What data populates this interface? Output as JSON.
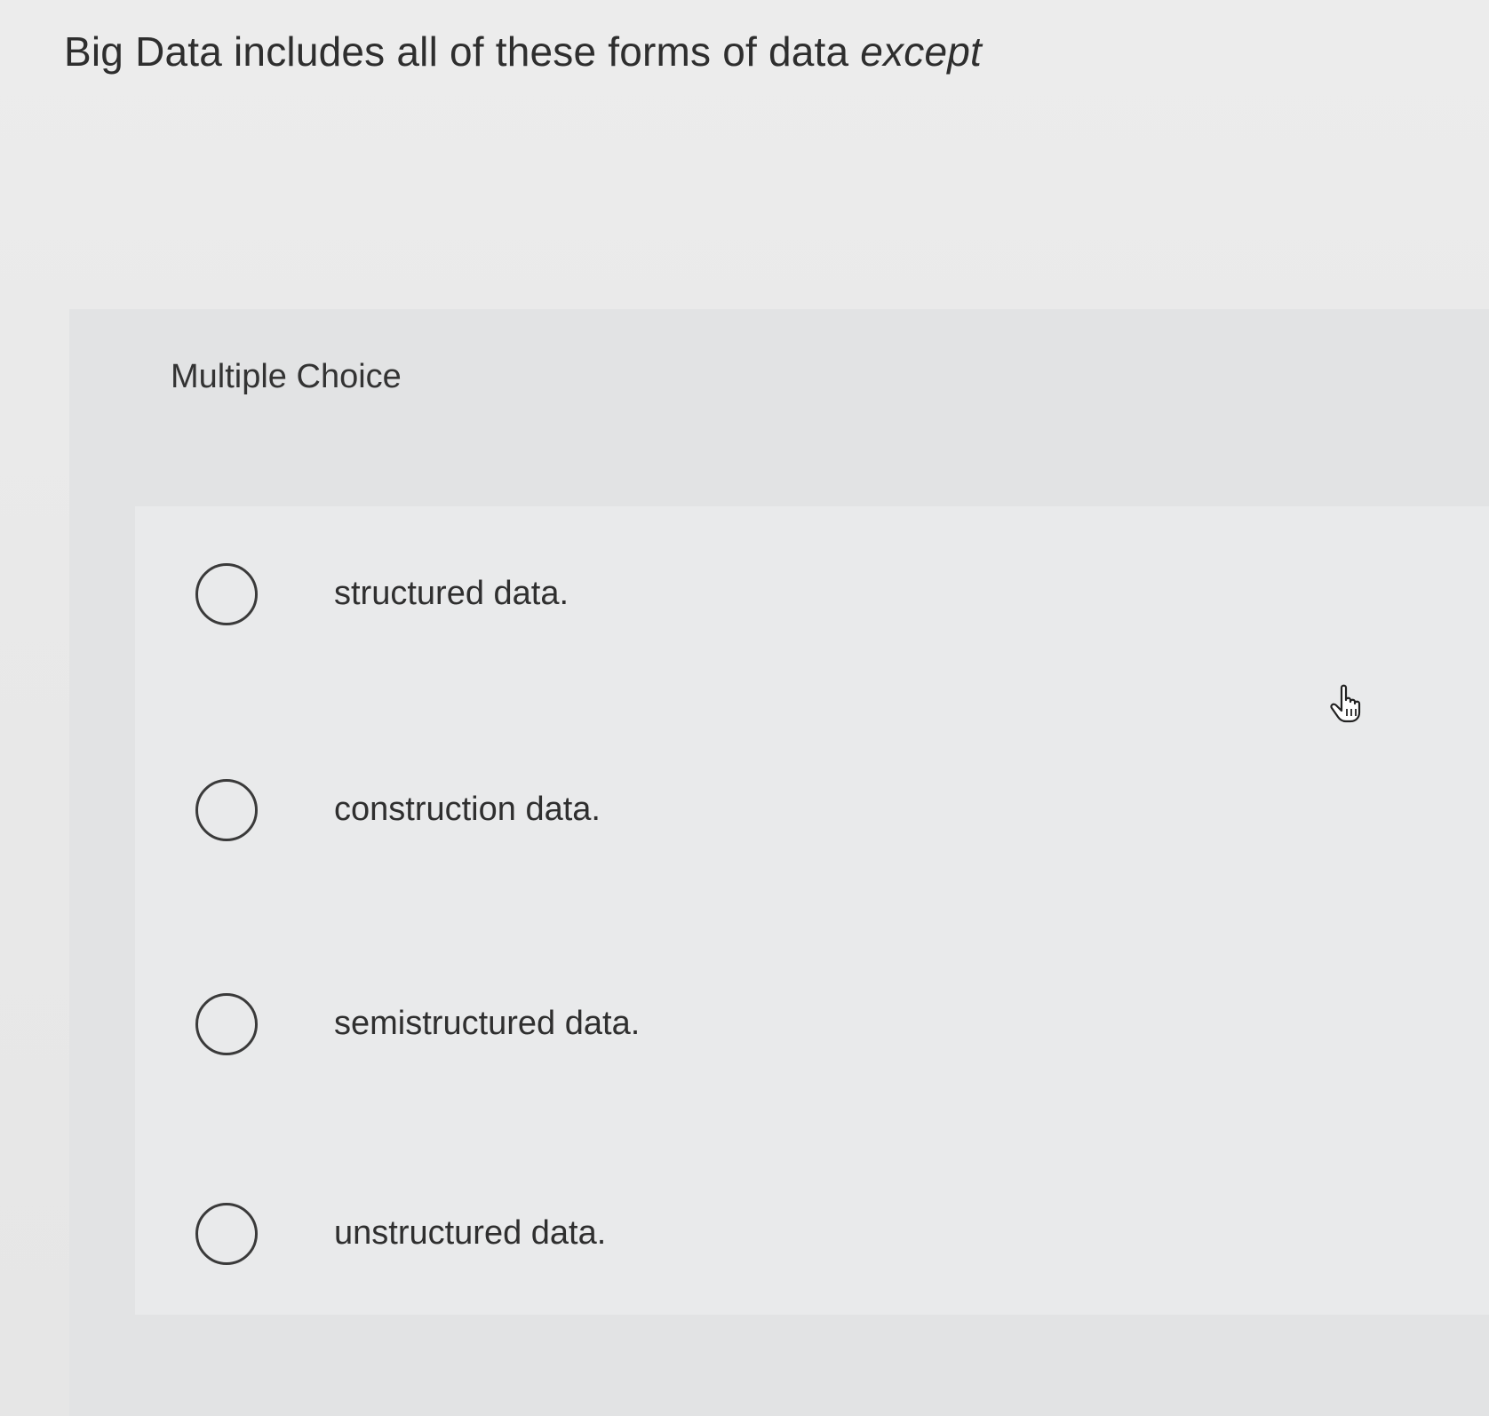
{
  "question": {
    "text": "Big Data includes all of these forms of data",
    "emphasis": "except"
  },
  "multiple_choice": {
    "label": "Multiple Choice",
    "options": [
      {
        "label": "structured data."
      },
      {
        "label": "construction data."
      },
      {
        "label": "semistructured data."
      },
      {
        "label": "unstructured data."
      }
    ]
  },
  "cursor": {
    "icon": "hand-pointer-icon"
  }
}
